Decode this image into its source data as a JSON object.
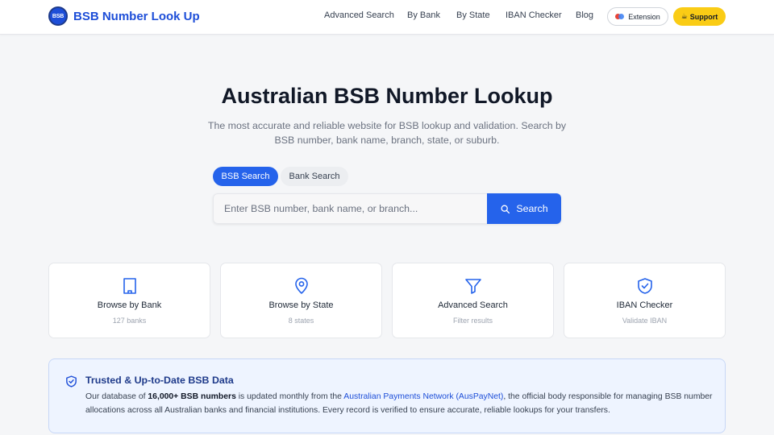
{
  "header": {
    "brand": "BSB Number Look Up",
    "logo_text": "BSB",
    "nav": [
      "Advanced Search",
      "By Bank",
      "By State",
      "IBAN Checker",
      "Blog"
    ],
    "extension_label": "Extension",
    "support_label": "Support",
    "support_emoji": "☕"
  },
  "hero": {
    "title": "Australian BSB Number Lookup",
    "subtitle": "The most accurate and reliable website for BSB lookup and validation. Search by BSB number, bank name, branch, state, or suburb."
  },
  "search": {
    "tabs": [
      "BSB Search",
      "Bank Search"
    ],
    "active_tab": "BSB Search",
    "placeholder": "Enter BSB number, bank name, or branch...",
    "value": "",
    "button_label": "Search"
  },
  "cards": [
    {
      "icon": "building-icon",
      "title": "Browse by Bank",
      "subtitle": "127 banks"
    },
    {
      "icon": "map-pin-icon",
      "title": "Browse by State",
      "subtitle": "8 states"
    },
    {
      "icon": "filter-icon",
      "title": "Advanced Search",
      "subtitle": "Filter results"
    },
    {
      "icon": "shield-check-icon",
      "title": "IBAN Checker",
      "subtitle": "Validate IBAN"
    }
  ],
  "trust": {
    "title": "Trusted & Up-to-Date BSB Data",
    "body_1": "Our database of ",
    "body_bold": "16,000+ BSB numbers",
    "body_2": " is updated monthly from the ",
    "body_link": "Australian Payments Network (AusPayNet)",
    "body_3": ", the official body responsible for managing BSB number allocations across all Australian banks and financial institutions. Every record is verified to ensure accurate, reliable lookups for your transfers."
  },
  "colors": {
    "primary": "#2563eb",
    "brand": "#1d4ed8",
    "support": "#facc15",
    "trust_bg": "#eef4ff"
  }
}
